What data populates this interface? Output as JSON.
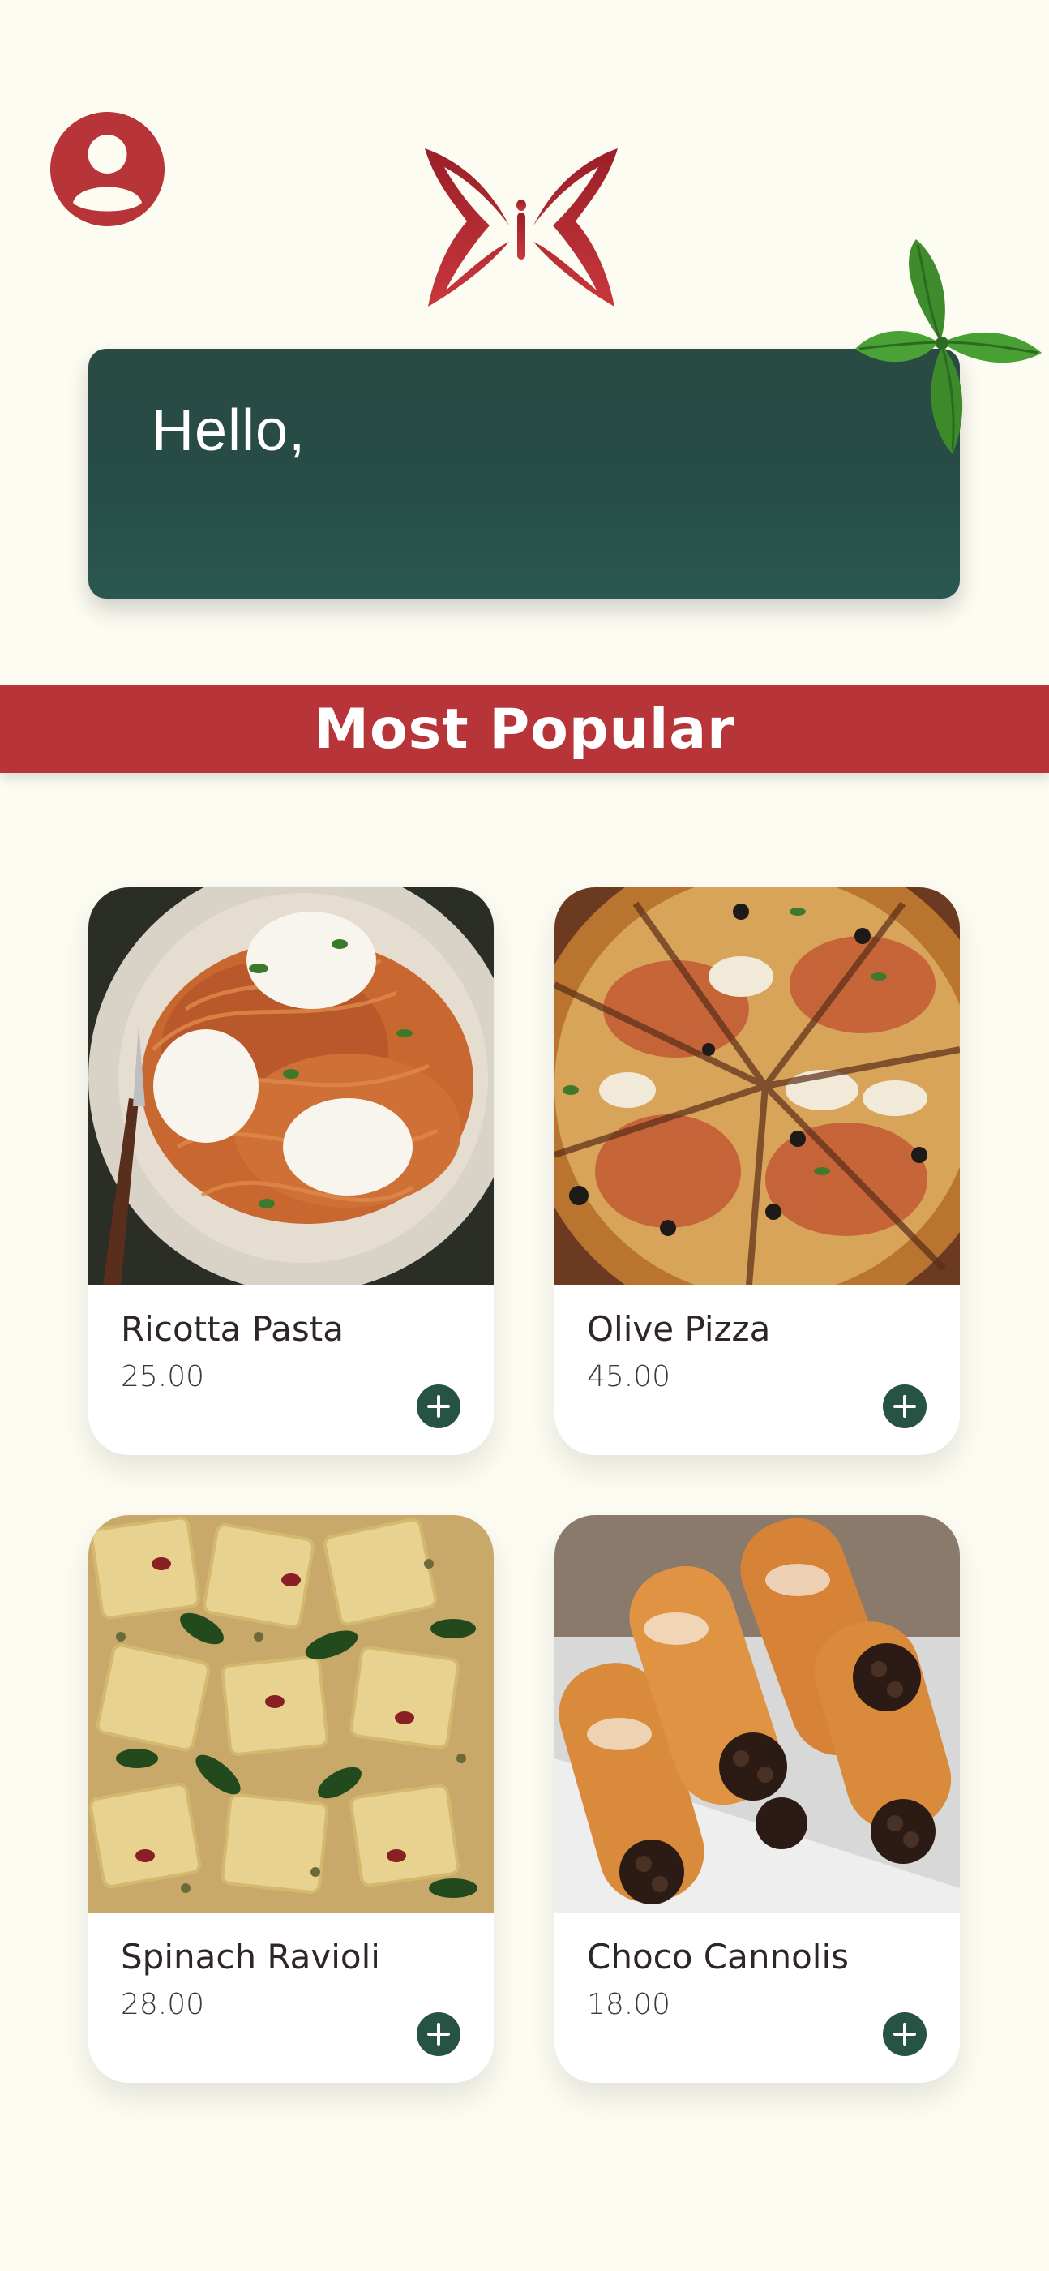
{
  "header": {
    "avatar_icon": "user-icon",
    "logo_icon": "butterfly-logo-icon",
    "decoration_icon": "mint-leaf-icon"
  },
  "greeting": {
    "text": "Hello,"
  },
  "section": {
    "title": "Most Popular"
  },
  "products": [
    {
      "name": "Ricotta Pasta",
      "price": "25.00",
      "image": "ricotta-pasta-photo"
    },
    {
      "name": "Olive Pizza",
      "price": "45.00",
      "image": "olive-pizza-photo"
    },
    {
      "name": "Spinach Ravioli",
      "price": "28.00",
      "image": "spinach-ravioli-photo"
    },
    {
      "name": "Choco Cannolis",
      "price": "18.00",
      "image": "choco-cannolis-photo"
    }
  ],
  "colors": {
    "background": "#fdfcf3",
    "brand_red": "#b73438",
    "brand_green": "#275346",
    "card": "#ffffff"
  }
}
